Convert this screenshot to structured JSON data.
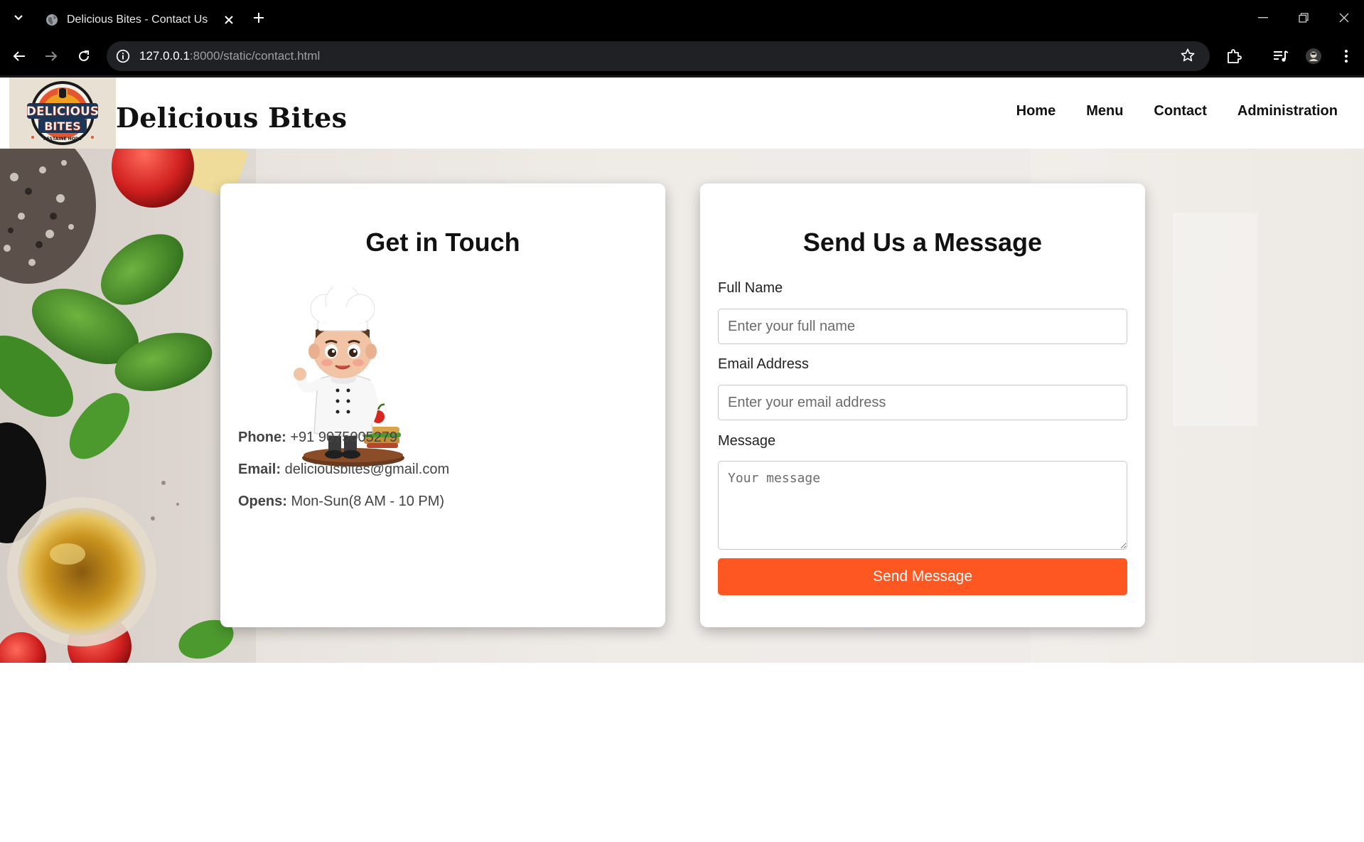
{
  "browser": {
    "tab_title": "Delicious Bites - Contact Us",
    "url_host": "127.0.0.1",
    "url_rest": ":8000/static/contact.html"
  },
  "site": {
    "brand": "Delicious Bites",
    "logo_text_top": "DELICIOUS",
    "logo_text_bottom": "BITES",
    "logo_tagline": "RESTAINE HODS",
    "nav": [
      {
        "label": "Home"
      },
      {
        "label": "Menu"
      },
      {
        "label": "Contact"
      },
      {
        "label": "Administration"
      }
    ]
  },
  "contact": {
    "title": "Get in Touch",
    "phone_label": "Phone:",
    "phone_value": "+91 9075005279",
    "email_label": "Email:",
    "email_value": "deliciousbites@gmail.com",
    "opens_label": "Opens:",
    "opens_value": "Mon-Sun(8 AM - 10 PM)"
  },
  "form": {
    "title": "Send Us a Message",
    "name_label": "Full Name",
    "name_placeholder": "Enter your full name",
    "email_label": "Email Address",
    "email_placeholder": "Enter your email address",
    "message_label": "Message",
    "message_placeholder": "Your message",
    "submit_label": "Send Message"
  },
  "colors": {
    "accent": "#ff5722",
    "chrome_bg": "#000000",
    "omnibox_bg": "#202124"
  },
  "icons": [
    "tab-search-icon",
    "globe-icon",
    "close-icon",
    "plus-icon",
    "minimize-icon",
    "restore-icon",
    "back-arrow-icon",
    "forward-arrow-icon",
    "reload-icon",
    "info-icon",
    "star-icon",
    "extensions-icon",
    "media-icon",
    "profile-icon",
    "kebab-menu-icon"
  ]
}
